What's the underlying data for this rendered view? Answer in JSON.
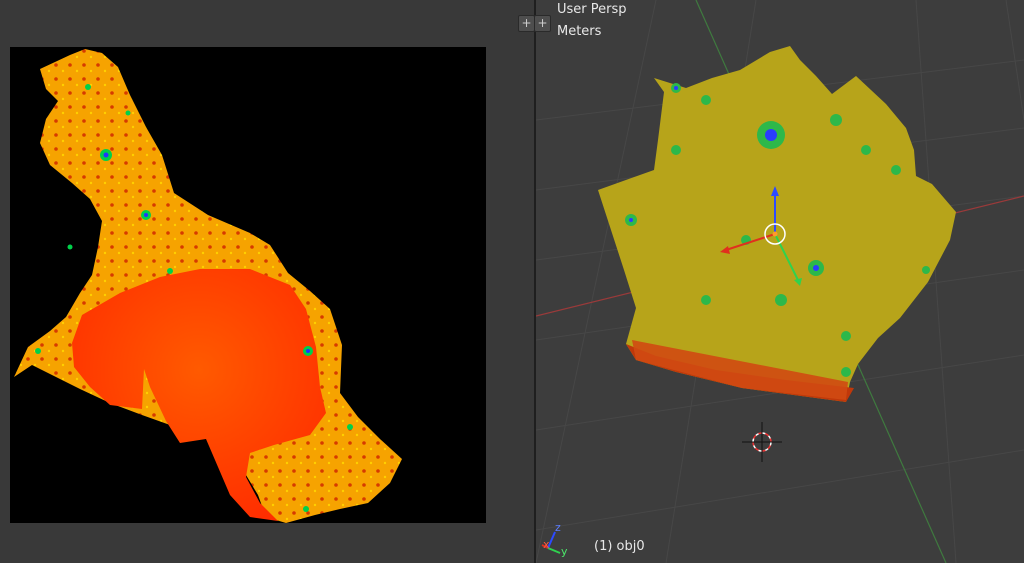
{
  "viewport": {
    "view_mode": "User Persp",
    "units": "Meters",
    "active_object": "(1) obj0",
    "add_buttons": [
      "+",
      "+"
    ]
  },
  "axes_gizmo": {
    "x": "x",
    "y": "y",
    "z": "z"
  },
  "colors": {
    "background_left": "#393939",
    "background_right": "#3d3d3d",
    "texture_bg": "#000000",
    "texture_orange": "#f8a200",
    "texture_red": "#ff3a00",
    "grid_x_axis": "#9a3a3a",
    "grid_y_axis": "#3f7a3f"
  }
}
